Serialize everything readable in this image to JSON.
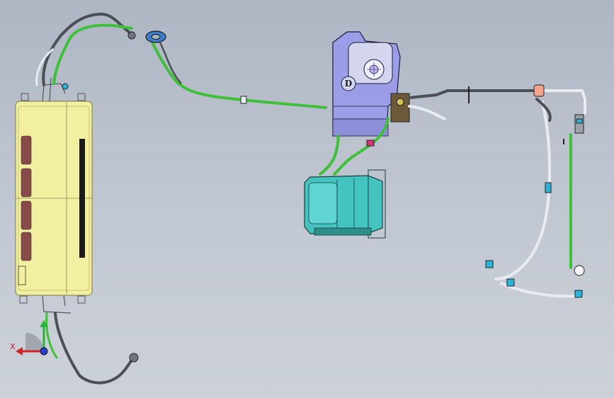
{
  "colors": {
    "background_top": "#aeb6c4",
    "background_bottom": "#ccd1d9",
    "condenser_body": "#f3efa0",
    "condenser_frame": "#8a8a55",
    "evaporator_housing": "#9b9ee6",
    "blower_panel": "#d4d6f0",
    "compressor_body": "#44c4c0",
    "hose_green": "#3fbf3a",
    "hose_white": "#e8ecf1",
    "hose_dark": "#4a4f55",
    "accent_magenta": "#d4347a",
    "accent_salmon": "#f2a38a",
    "axis_x": "#d0242a",
    "axis_y": "#27b33a",
    "axis_z": "#2b3fd6"
  },
  "scene": {
    "evaporator_badge": "D",
    "axis_triad": {
      "x_label": "X"
    }
  },
  "icons": {
    "triad": "axis-triad-icon",
    "blower": "blower-fan-icon"
  }
}
